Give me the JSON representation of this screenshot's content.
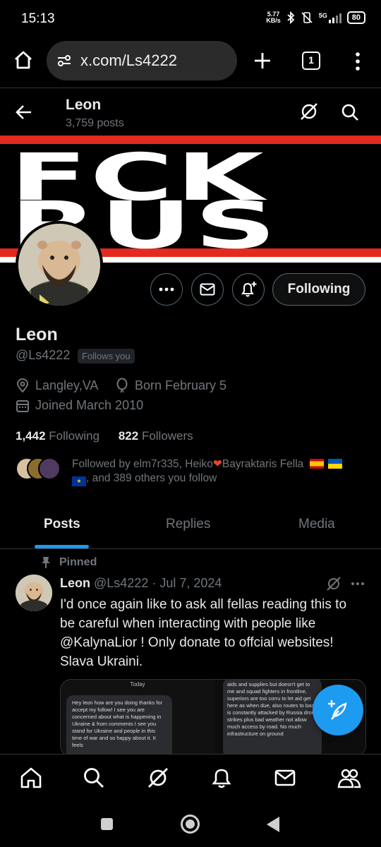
{
  "status_bar": {
    "time": "15:13",
    "net_speed_value": "5.77",
    "net_speed_unit": "KB/s",
    "signal_label": "5G",
    "battery": "80"
  },
  "browser": {
    "url": "x.com/Ls4222",
    "tab_count": "1"
  },
  "header": {
    "name": "Leon",
    "post_count": "3,759 posts"
  },
  "banner": {
    "line1": "FCK",
    "line2": "RUS"
  },
  "profile": {
    "action_follow_label": "Following",
    "display_name": "Leon",
    "handle": "@Ls4222",
    "follows_you": "Follows you",
    "location": "Langley,VA",
    "birthday": "Born February 5",
    "joined": "Joined March 2010",
    "following_count": "1,442",
    "following_label": "Following",
    "followers_count": "822",
    "followers_label": "Followers",
    "followed_by_text": "Followed by elm7r335, Heiko",
    "followed_by_text2": "Bayraktaris Fella",
    "followed_by_text3": ", and 389 others you follow"
  },
  "tabs": [
    {
      "label": "Posts"
    },
    {
      "label": "Replies"
    },
    {
      "label": "Media"
    }
  ],
  "post": {
    "pinned_label": "Pinned",
    "author": "Leon",
    "meta": "@Ls4222 · Jul 7, 2024",
    "text": "I'd once again like to ask all fellas reading this to be careful when interacting with people like @KalynaLior ! Only donate to offcial websites! Slava Ukraini.",
    "media_today": "Today",
    "media_left_text": "Hey leon how are you doing thanks for accept my follow! I see you are concerned about what is happening in Ukraine & from comments I see you stand for Ukraine and people in this time of war and so happy about it. It feels",
    "media_right_text": "aids and supplies but doesn't get to me and squad fighters in frontline, superiors are too corru to let aid get here as when due, also routes to base is constantly attacked by Russia drone strikes plus bad weather not allow much access by road. No much infrastructure on ground"
  },
  "colors": {
    "accent": "#1d9bf0",
    "banner_red": "#e42a1f",
    "muted_text": "#71767b"
  }
}
